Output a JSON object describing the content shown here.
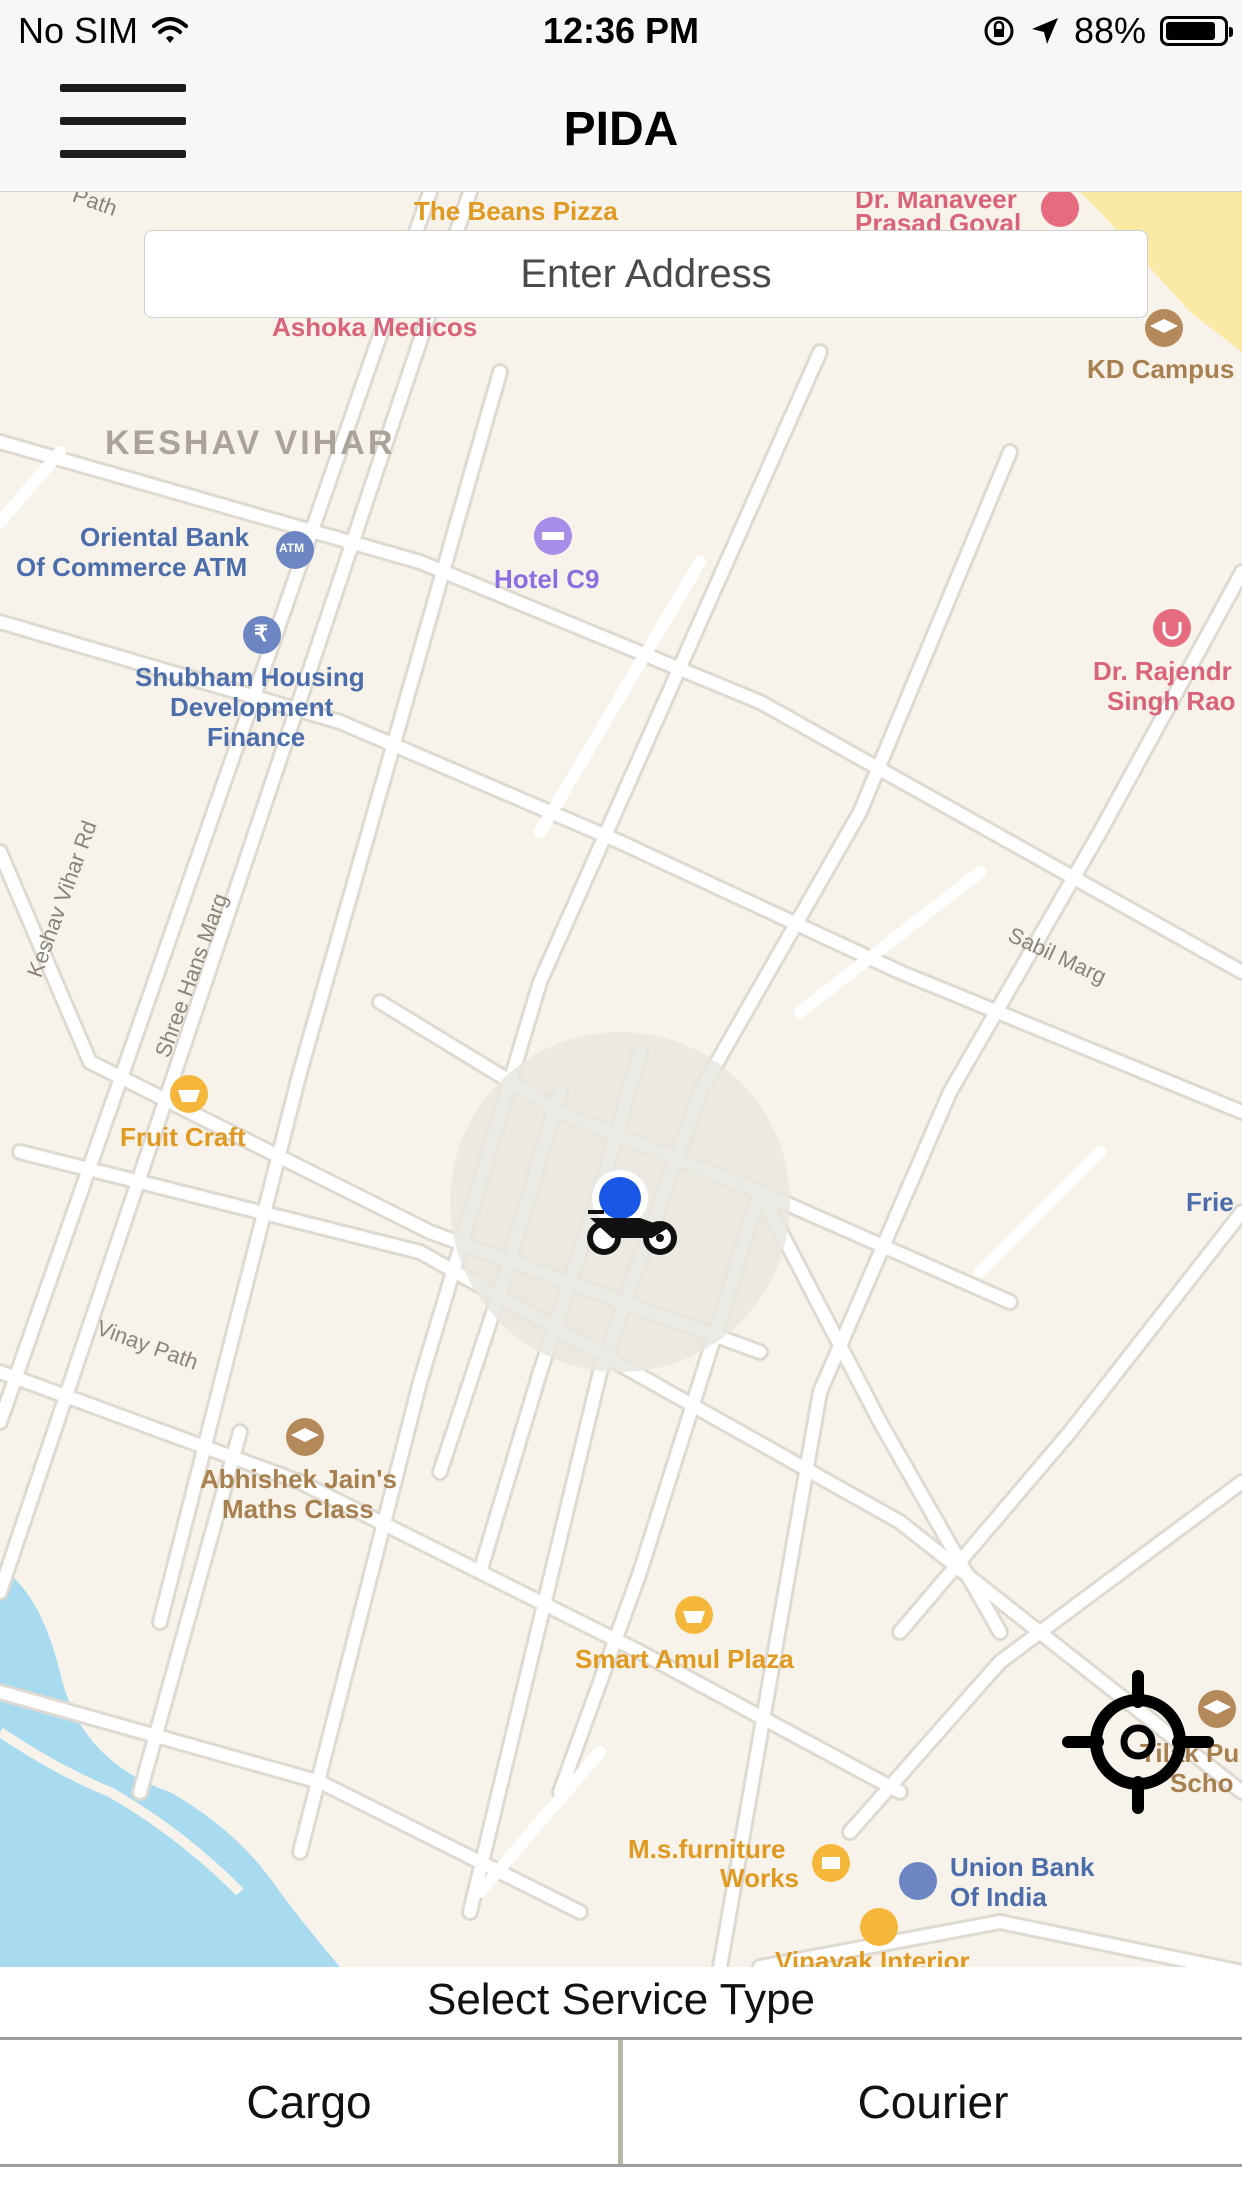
{
  "status_bar": {
    "carrier": "No SIM",
    "time": "12:36 PM",
    "battery_percent": "88%",
    "battery_level": 0.88,
    "icons": [
      "wifi-icon",
      "orientation-lock-icon",
      "location-arrow-icon",
      "battery-icon"
    ]
  },
  "nav": {
    "title": "PIDA",
    "menu_icon": "hamburger-menu-icon"
  },
  "search": {
    "placeholder": "Enter Address"
  },
  "map": {
    "colors": {
      "land": "#f8f3ea",
      "road": "#ffffff",
      "water": "#a8daf0",
      "poi_food": "#e59a1e",
      "poi_medical": "#d95b6e",
      "poi_education": "#a88050",
      "poi_finance": "#4b6dab",
      "poi_hotel": "#9a7ee0",
      "user_location": "#1a57e6"
    },
    "area_label": "KESHAV VIHAR",
    "street_labels": [
      "Vinay Path",
      "Sabil Marg",
      "Keshav Vihar Rd",
      "Shree Hans Marg",
      "Path"
    ],
    "places": {
      "beans_pizza": "The Beans Pizza",
      "ashoka": "Ashoka Medicos",
      "manaveer_1": "Dr. Manaveer",
      "manaveer_2": "Prasad Goyal",
      "kd": "KD Campus",
      "oriental_1": "Oriental Bank",
      "oriental_2": "Of Commerce ATM",
      "hotel": "Hotel C9",
      "shubham_1": "Shubham Housing",
      "shubham_2": "Development",
      "shubham_3": "Finance",
      "rajendra_1": "Dr. Rajendr",
      "rajendra_2": "Singh Rao",
      "fruit": "Fruit Craft",
      "frie": "Frie",
      "abhishek_1": "Abhishek Jain's",
      "abhishek_2": "Maths Class",
      "amul": "Smart Amul Plaza",
      "ms_1": "M.s.furniture",
      "ms_2": "Works",
      "union_1": "Union Bank",
      "union_2": "Of India",
      "tilak_1": "Tilak Pu",
      "tilak_2": "Scho",
      "vinayak": "Vinayak Interior"
    },
    "atm_badge": "ATM",
    "rupee_symbol": "₹",
    "vehicle_icon": "motorcycle-icon",
    "locate_icon": "crosshair-target-icon"
  },
  "service": {
    "title": "Select Service Type",
    "options": [
      {
        "label": "Cargo"
      },
      {
        "label": "Courier"
      }
    ]
  }
}
